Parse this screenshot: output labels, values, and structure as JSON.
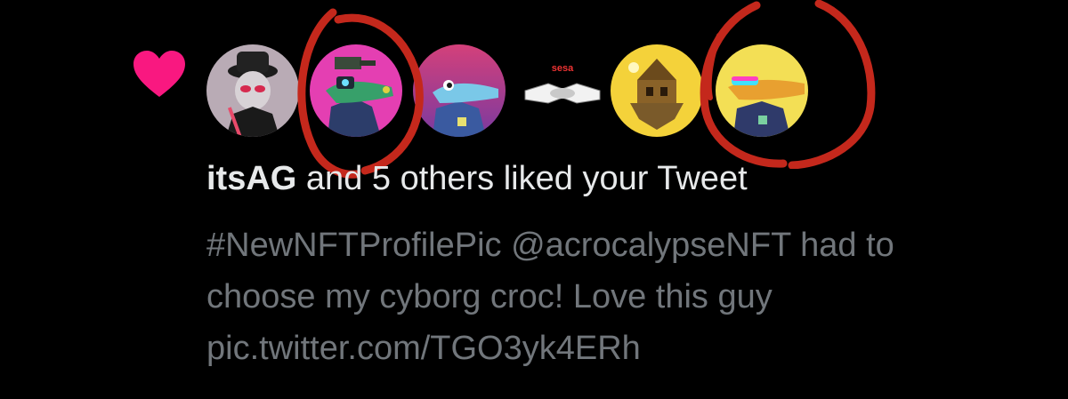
{
  "notification": {
    "icon": "heart-icon",
    "heart_color": "#f91880",
    "liker_username": "itsAG",
    "summary_rest": "and 5 others liked your Tweet",
    "avatars": [
      {
        "name": "avatar-itsag",
        "bg": "#b8a9b3"
      },
      {
        "name": "avatar-cyborg-croc",
        "bg": "#e83fb0"
      },
      {
        "name": "avatar-croc-pink",
        "bg": "#c8427a"
      },
      {
        "name": "avatar-sesa",
        "bg": "#000000"
      },
      {
        "name": "avatar-yellow-treehouse",
        "bg": "#f5d33b"
      },
      {
        "name": "avatar-croc-yellow",
        "bg": "#f3e25a"
      }
    ],
    "tweet_lines": [
      "#NewNFTProfilePic @acrocalypseNFT had to",
      "choose my cyborg croc! Love this guy",
      "pic.twitter.com/TGO3yk4ERh"
    ],
    "sesa_label": "sesa"
  },
  "annotations": {
    "circle_color": "#c4281c"
  }
}
